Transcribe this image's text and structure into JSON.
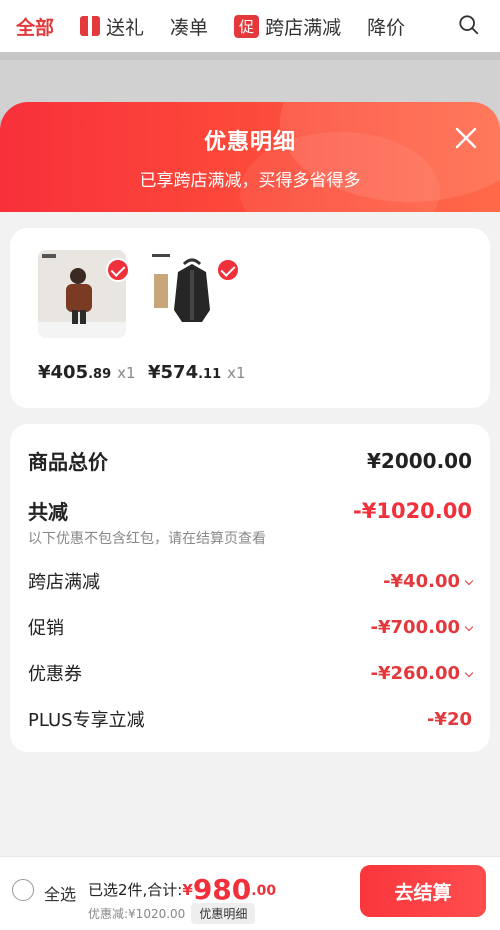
{
  "tabs": [
    {
      "label": "全部",
      "active": true
    },
    {
      "label": "送礼",
      "icon": "gift-icon"
    },
    {
      "label": "凑单"
    },
    {
      "label": "跨店满减",
      "tag": "促"
    },
    {
      "label": "降价"
    }
  ],
  "modal": {
    "title": "优惠明细",
    "subtitle": "已享跨店满减，买得多省得多"
  },
  "products": [
    {
      "price_int": "¥405",
      "price_dec": ".89",
      "qty": "x1"
    },
    {
      "price_int": "¥574",
      "price_dec": ".11",
      "qty": "x1"
    }
  ],
  "summary": {
    "total_label": "商品总价",
    "total_value": "¥2000.00",
    "reduce_label": "共减",
    "reduce_value": "-¥1020.00",
    "note": "以下优惠不包含红包，请在结算页查看",
    "items": [
      {
        "label": "跨店满减",
        "value": "-¥40.00"
      },
      {
        "label": "促销",
        "value": "-¥700.00"
      },
      {
        "label": "优惠券",
        "value": "-¥260.00"
      },
      {
        "label": "PLUS专享立减",
        "value": "-¥20"
      }
    ]
  },
  "bottom": {
    "select_all": "全选",
    "selected_text": "已选2件,合计:",
    "currency": "¥",
    "amount": "980",
    "amount_dec": ".00",
    "discount_text": "优惠减:¥1020.00",
    "detail_button": "优惠明细",
    "checkout_button": "去结算"
  },
  "colors": {
    "accent": "#f0303a"
  }
}
